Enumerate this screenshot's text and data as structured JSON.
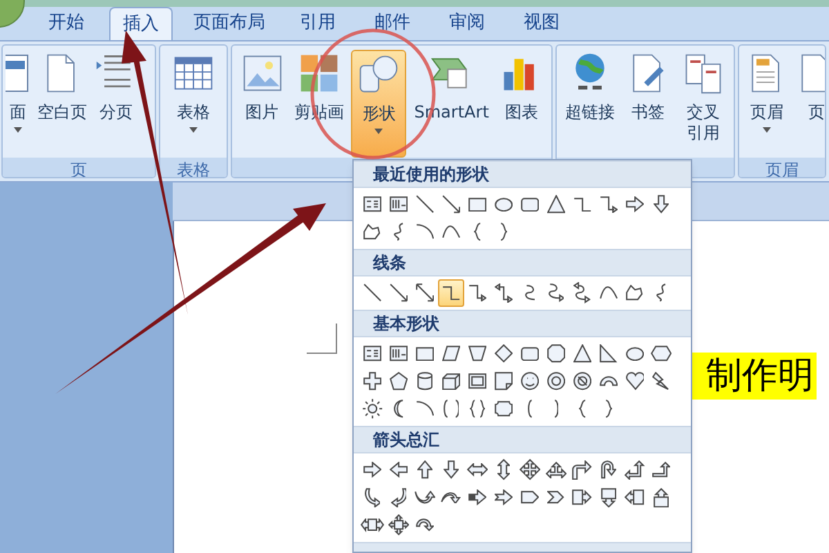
{
  "tabs": [
    {
      "label": "开始",
      "selected": false
    },
    {
      "label": "插入",
      "selected": true
    },
    {
      "label": "页面布局",
      "selected": false
    },
    {
      "label": "引用",
      "selected": false
    },
    {
      "label": "邮件",
      "selected": false
    },
    {
      "label": "审阅",
      "selected": false
    },
    {
      "label": "视图",
      "selected": false
    }
  ],
  "ribbon_groups": [
    {
      "label": "页",
      "buttons": [
        {
          "label": "面",
          "has_menu": true,
          "active": false
        },
        {
          "label": "空白页",
          "has_menu": false,
          "active": false
        },
        {
          "label": "分页",
          "has_menu": false,
          "active": false
        }
      ]
    },
    {
      "label": "表格",
      "buttons": [
        {
          "label": "表格",
          "has_menu": true,
          "active": false
        }
      ]
    },
    {
      "buttons": [
        {
          "label": "图片",
          "has_menu": false,
          "active": false
        },
        {
          "label": "剪贴画",
          "has_menu": false,
          "active": false
        },
        {
          "label": "形状",
          "has_menu": true,
          "active": true
        },
        {
          "label": "SmartArt",
          "has_menu": false,
          "active": false
        },
        {
          "label": "图表",
          "has_menu": false,
          "active": false
        }
      ]
    },
    {
      "buttons": [
        {
          "label": "超链接",
          "has_menu": false,
          "active": false
        },
        {
          "label": "书签",
          "has_menu": false,
          "active": false
        },
        {
          "label": "交叉引用",
          "has_menu": false,
          "active": false
        }
      ]
    },
    {
      "label": "页眉",
      "buttons": [
        {
          "label": "页眉",
          "has_menu": true,
          "active": false
        },
        {
          "label": "页",
          "has_menu": false,
          "active": false
        }
      ]
    }
  ],
  "shapes_menu": {
    "sections": [
      {
        "title": "最近使用的形状",
        "shapes": [
          {
            "kind": "textbox",
            "selected": false
          },
          {
            "kind": "vtextbox",
            "selected": false
          },
          {
            "kind": "line",
            "selected": false
          },
          {
            "kind": "arrow",
            "selected": false
          },
          {
            "kind": "rect",
            "selected": false
          },
          {
            "kind": "oval",
            "selected": false
          },
          {
            "kind": "roundrect",
            "selected": false
          },
          {
            "kind": "triangle",
            "selected": false
          },
          {
            "kind": "elbow",
            "selected": false
          },
          {
            "kind": "elbowarrow",
            "selected": false
          },
          {
            "kind": "rightarrow",
            "selected": false
          },
          {
            "kind": "downarrow",
            "selected": false
          },
          {
            "kind": "freeform",
            "selected": false
          },
          {
            "kind": "scribble",
            "selected": false
          },
          {
            "kind": "arc",
            "selected": false
          },
          {
            "kind": "curve",
            "selected": false
          },
          {
            "kind": "leftbrace",
            "selected": false
          },
          {
            "kind": "rightbrace",
            "selected": false
          }
        ]
      },
      {
        "title": "线条",
        "shapes": [
          {
            "kind": "line",
            "selected": false
          },
          {
            "kind": "arrow",
            "selected": false
          },
          {
            "kind": "doublearrow",
            "selected": false
          },
          {
            "kind": "elbow",
            "selected": true
          },
          {
            "kind": "elbowarrow",
            "selected": false
          },
          {
            "kind": "elbowdouble",
            "selected": false
          },
          {
            "kind": "curvedconn",
            "selected": false
          },
          {
            "kind": "curvedarrow",
            "selected": false
          },
          {
            "kind": "curveddouble",
            "selected": false
          },
          {
            "kind": "curve",
            "selected": false
          },
          {
            "kind": "freeform",
            "selected": false
          },
          {
            "kind": "scribble",
            "selected": false
          }
        ]
      },
      {
        "title": "基本形状",
        "shapes": [
          {
            "kind": "textbox",
            "selected": false
          },
          {
            "kind": "vtextbox",
            "selected": false
          },
          {
            "kind": "rect",
            "selected": false
          },
          {
            "kind": "parallelogram",
            "selected": false
          },
          {
            "kind": "trapezoid",
            "selected": false
          },
          {
            "kind": "diamond",
            "selected": false
          },
          {
            "kind": "roundrect",
            "selected": false
          },
          {
            "kind": "octagon",
            "selected": false
          },
          {
            "kind": "triangle",
            "selected": false
          },
          {
            "kind": "righttriangle",
            "selected": false
          },
          {
            "kind": "oval",
            "selected": false
          },
          {
            "kind": "hexagon",
            "selected": false
          },
          {
            "kind": "cross",
            "selected": false
          },
          {
            "kind": "pentagon",
            "selected": false
          },
          {
            "kind": "can",
            "selected": false
          },
          {
            "kind": "cube",
            "selected": false
          },
          {
            "kind": "bevel",
            "selected": false
          },
          {
            "kind": "foldedcorner",
            "selected": false
          },
          {
            "kind": "smiley",
            "selected": false
          },
          {
            "kind": "donut",
            "selected": false
          },
          {
            "kind": "nosymbol",
            "selected": false
          },
          {
            "kind": "blockarc",
            "selected": false
          },
          {
            "kind": "heart",
            "selected": false
          },
          {
            "kind": "lightning",
            "selected": false
          },
          {
            "kind": "sun",
            "selected": false
          },
          {
            "kind": "moon",
            "selected": false
          },
          {
            "kind": "arc",
            "selected": false
          },
          {
            "kind": "bracketpair",
            "selected": false
          },
          {
            "kind": "bracepair",
            "selected": false
          },
          {
            "kind": "plaque",
            "selected": false
          },
          {
            "kind": "leftbracket",
            "selected": false
          },
          {
            "kind": "rightbracket",
            "selected": false
          },
          {
            "kind": "leftbrace",
            "selected": false
          },
          {
            "kind": "rightbrace",
            "selected": false
          }
        ]
      },
      {
        "title": "箭头总汇",
        "shapes": [
          {
            "kind": "rightarrow",
            "selected": false
          },
          {
            "kind": "leftarrow",
            "selected": false
          },
          {
            "kind": "uparrow",
            "selected": false
          },
          {
            "kind": "downarrow",
            "selected": false
          },
          {
            "kind": "leftrightarrow",
            "selected": false
          },
          {
            "kind": "updownarrow",
            "selected": false
          },
          {
            "kind": "quadarrow",
            "selected": false
          },
          {
            "kind": "leftrightuparrow",
            "selected": false
          },
          {
            "kind": "bentarrow",
            "selected": false
          },
          {
            "kind": "uturnarrow",
            "selected": false
          },
          {
            "kind": "leftuparrow",
            "selected": false
          },
          {
            "kind": "bentuparrow",
            "selected": false
          },
          {
            "kind": "curvedright",
            "selected": false
          },
          {
            "kind": "curvedleft",
            "selected": false
          },
          {
            "kind": "curvedup",
            "selected": false
          },
          {
            "kind": "curveddown",
            "selected": false
          },
          {
            "kind": "stripedright",
            "selected": false
          },
          {
            "kind": "notchedright",
            "selected": false
          },
          {
            "kind": "pentagonarrow",
            "selected": false
          },
          {
            "kind": "chevron",
            "selected": false
          },
          {
            "kind": "rightcallout",
            "selected": false
          },
          {
            "kind": "downcallout",
            "selected": false
          },
          {
            "kind": "leftcallout",
            "selected": false
          },
          {
            "kind": "upcallout",
            "selected": false
          },
          {
            "kind": "leftrightcallout",
            "selected": false
          },
          {
            "kind": "quadcallout",
            "selected": false
          },
          {
            "kind": "circulararrow",
            "selected": false
          }
        ]
      }
    ]
  },
  "document": {
    "highlighted_text": "制作明"
  }
}
